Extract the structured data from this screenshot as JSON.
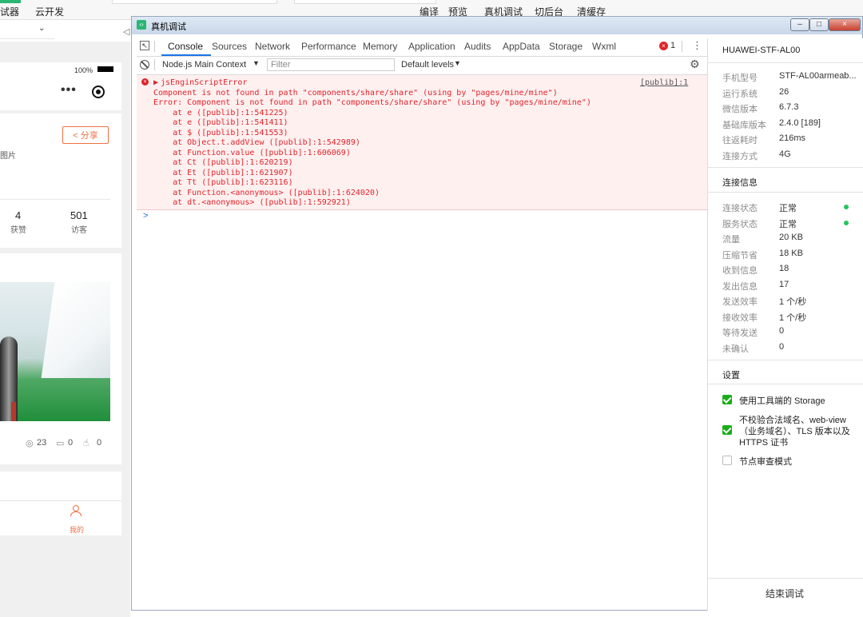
{
  "ide": {
    "top_left_items": [
      "试器",
      "云开发"
    ],
    "top_center_items": [
      "编译",
      "预览",
      "真机调试",
      "切后台",
      "清缓存"
    ]
  },
  "simulator": {
    "status_battery": "100%",
    "share_label": "分享",
    "image_label_fragment": "图片",
    "stats": [
      {
        "value": "4",
        "label": "获赞"
      },
      {
        "value": "501",
        "label": "访客"
      }
    ],
    "post_counts": {
      "views": "23",
      "comments": "0",
      "likes": "0"
    },
    "tabbar_mine_label": "我的"
  },
  "devtools": {
    "window_title": "真机调试",
    "tabs": [
      "Console",
      "Sources",
      "Network",
      "Performance",
      "Memory",
      "Application",
      "Audits",
      "AppData",
      "Storage",
      "Wxml"
    ],
    "active_tab": "Console",
    "error_count": "1",
    "context_select": "Node.js Main Context",
    "filter_placeholder": "Filter",
    "levels_select": "Default levels",
    "console": {
      "error_title": "jsEnginScriptError",
      "source_link": "[publib]:1",
      "lines": [
        "Component is not found in path \"components/share/share\" (using by \"pages/mine/mine\")",
        "Error: Component is not found in path \"components/share/share\" (using by \"pages/mine/mine\")",
        "    at e ([publib]:1:541225)",
        "    at e ([publib]:1:541411)",
        "    at $ ([publib]:1:541553)",
        "    at Object.t.addView ([publib]:1:542989)",
        "    at Function.value ([publib]:1:606069)",
        "    at Ct ([publib]:1:620219)",
        "    at Et ([publib]:1:621907)",
        "    at Tt ([publib]:1:623116)",
        "    at Function.<anonymous> ([publib]:1:624020)",
        "    at dt.<anonymous> ([publib]:1:592921)"
      ],
      "prompt": ">"
    }
  },
  "device_panel": {
    "device_name": "HUAWEI-STF-AL00",
    "info": [
      {
        "label": "手机型号",
        "value": "STF-AL00armeab..."
      },
      {
        "label": "运行系统",
        "value": "26"
      },
      {
        "label": "微信版本",
        "value": "6.7.3"
      },
      {
        "label": "基础库版本",
        "value": "2.4.0 [189]"
      },
      {
        "label": "往返耗时",
        "value": "216ms"
      },
      {
        "label": "连接方式",
        "value": "4G"
      }
    ],
    "conn_header": "连接信息",
    "conn": [
      {
        "label": "连接状态",
        "value": "正常"
      },
      {
        "label": "服务状态",
        "value": "正常"
      },
      {
        "label": "流量",
        "value": "20 KB"
      },
      {
        "label": "压缩节省",
        "value": "18 KB"
      },
      {
        "label": "收到信息",
        "value": "18"
      },
      {
        "label": "发出信息",
        "value": "17"
      },
      {
        "label": "发送效率",
        "value": "1 个/秒"
      },
      {
        "label": "接收效率",
        "value": "1 个/秒"
      },
      {
        "label": "等待发送",
        "value": "0"
      },
      {
        "label": "未确认",
        "value": "0"
      }
    ],
    "settings_header": "设置",
    "settings": [
      {
        "label": "使用工具端的 Storage",
        "checked": true
      },
      {
        "label": "不校验合法域名、web-view（业务域名）、TLS 版本以及 HTTPS 证书",
        "checked": true
      },
      {
        "label": "节点审查模式",
        "checked": false
      }
    ],
    "end_button": "结束调试"
  }
}
